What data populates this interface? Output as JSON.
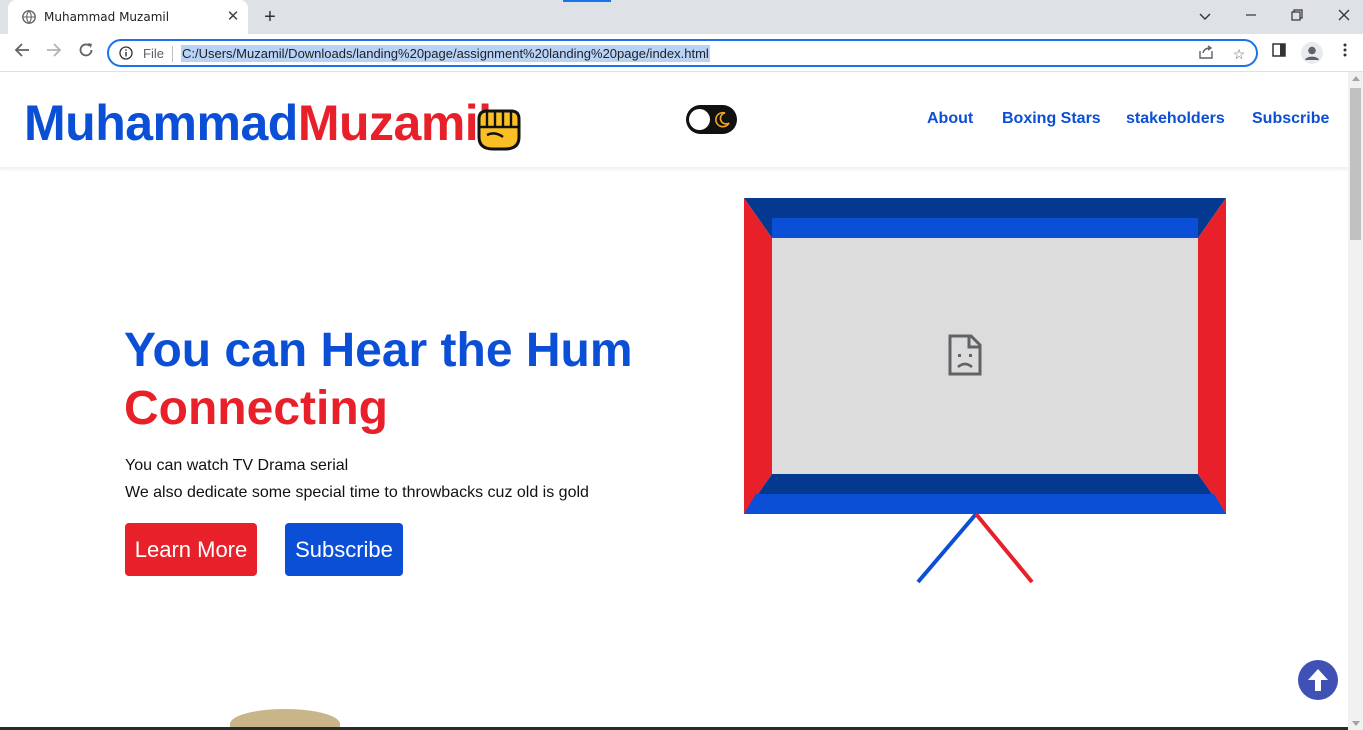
{
  "browser": {
    "tab_title": "Muhammad Muzamil",
    "new_tab_label": "+",
    "omnibox_scheme": "File",
    "url": "C:/Users/Muzamil/Downloads/landing%20page/assignment%20landing%20page/index.html"
  },
  "header": {
    "logo_first": "Muhammad",
    "logo_last": "Muzamil",
    "nav": [
      {
        "label": "About"
      },
      {
        "label": "Boxing Stars"
      },
      {
        "label": "stakeholders"
      },
      {
        "label": "Subscribe"
      }
    ]
  },
  "hero": {
    "title_line1": "You can Hear the Hum",
    "title_line2": "Connecting",
    "paragraph_line1": "You can watch TV Drama serial",
    "paragraph_line2": "We also dedicate some special time to throwbacks cuz old is gold",
    "learn_more_label": "Learn More",
    "subscribe_label": "Subscribe"
  },
  "colors": {
    "brand_blue": "#0b4fd6",
    "brand_red": "#e8202a",
    "dark_blue": "#05388f",
    "back_to_top": "#3f51b5"
  },
  "icons": {
    "fist": "fist-icon",
    "theme_toggle": "moon-icon",
    "broken_media": "broken-file-icon",
    "back_to_top": "arrow-up-icon"
  }
}
